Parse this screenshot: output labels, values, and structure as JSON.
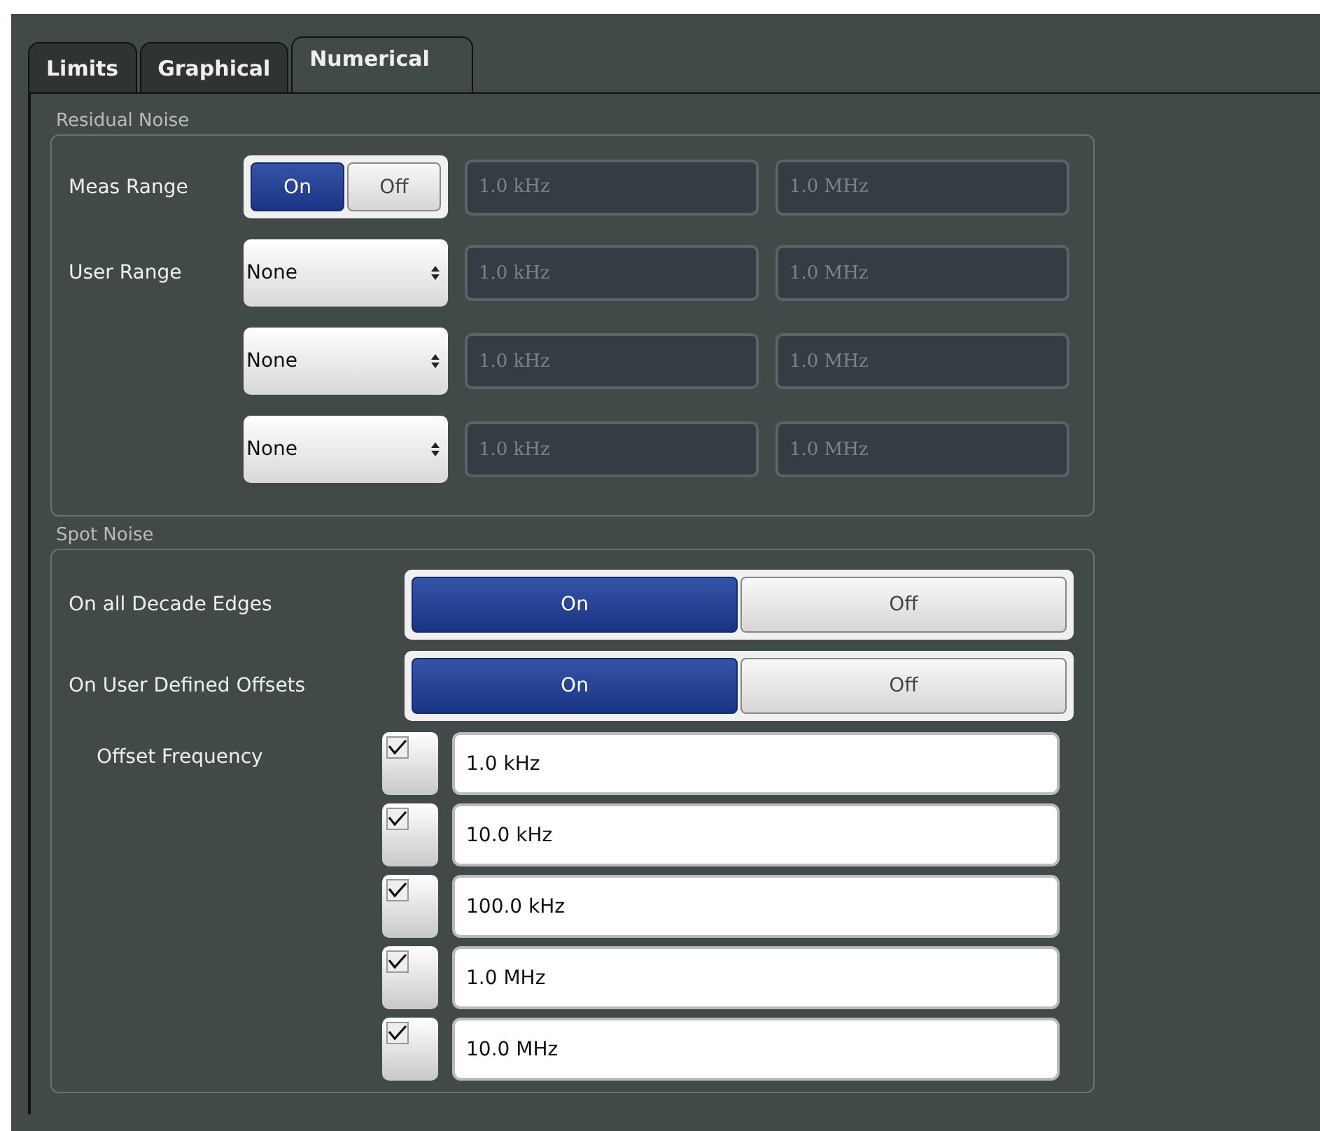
{
  "tabs": [
    {
      "label": "Limits",
      "selected": false
    },
    {
      "label": "Graphical",
      "selected": false
    },
    {
      "label": "Numerical",
      "selected": true
    }
  ],
  "residual_noise": {
    "title": "Residual Noise",
    "meas_range": {
      "label": "Meas Range",
      "options": [
        {
          "label": "On",
          "selected": true
        },
        {
          "label": "Off",
          "selected": false
        }
      ],
      "start": {
        "value": "1.0 kHz",
        "disabled": true
      },
      "stop": {
        "value": "1.0 MHz",
        "disabled": true
      }
    },
    "user_range": {
      "label": "User Range",
      "rows": [
        {
          "select": "None",
          "start": {
            "value": "1.0 kHz",
            "disabled": true
          },
          "stop": {
            "value": "1.0 MHz",
            "disabled": true
          }
        },
        {
          "select": "None",
          "start": {
            "value": "1.0 kHz",
            "disabled": true
          },
          "stop": {
            "value": "1.0 MHz",
            "disabled": true
          }
        },
        {
          "select": "None",
          "start": {
            "value": "1.0 kHz",
            "disabled": true
          },
          "stop": {
            "value": "1.0 MHz",
            "disabled": true
          }
        }
      ]
    }
  },
  "spot_noise": {
    "title": "Spot Noise",
    "toggles": [
      {
        "label": "On all Decade Edges",
        "options": [
          {
            "label": "On",
            "selected": true
          },
          {
            "label": "Off",
            "selected": false
          }
        ]
      },
      {
        "label": "On User Defined Offsets",
        "options": [
          {
            "label": "On",
            "selected": true
          },
          {
            "label": "Off",
            "selected": false
          }
        ]
      }
    ],
    "offset_frequency": {
      "label": "Offset Frequency",
      "rows": [
        {
          "checked": true,
          "value": "1.0 kHz"
        },
        {
          "checked": true,
          "value": "10.0 kHz"
        },
        {
          "checked": true,
          "value": "100.0 kHz"
        },
        {
          "checked": true,
          "value": "1.0 MHz"
        },
        {
          "checked": true,
          "value": "10.0 MHz"
        }
      ]
    }
  }
}
